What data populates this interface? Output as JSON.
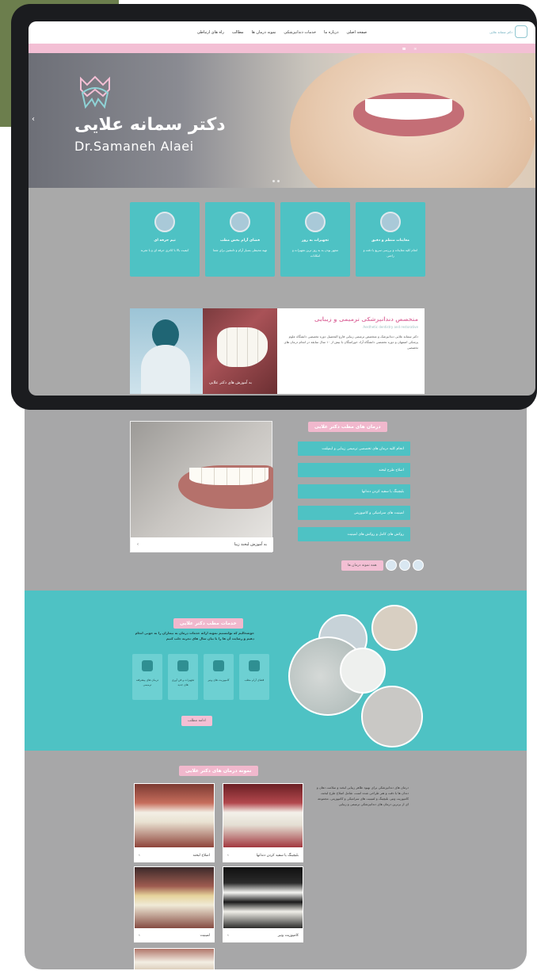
{
  "nav": {
    "items": [
      "صفحه اصلی",
      "درباره ما",
      "خدمات دندانپزشکی",
      "نمونه درمان ها",
      "مطالب",
      "راه های ارتباطی"
    ],
    "logo_text": "دکتر سمانه علایی"
  },
  "hero": {
    "title_fa": "دکتر سمانه علایی",
    "title_en": "Dr.Samaneh Alaei"
  },
  "service_cards": [
    {
      "title": "معاینات منظم و دقیق",
      "desc": "انجام کلیه معاینات و بررسی سریع با دقت و راحتی"
    },
    {
      "title": "تجهیزات به روز",
      "desc": "مجهز بودن به به روز ترین تجهیزات و امکانات"
    },
    {
      "title": "فضای آرام بخش مطب",
      "desc": "تهیه محیطی بسیار آرام و دلنشین برای شما"
    },
    {
      "title": "تیم حرفه ای",
      "desc": "کیفیت بالا با کادری حرفه ای و با تجربه"
    }
  ],
  "about": {
    "heading": "متخصص دندانپزشکی ترمیمی و زیبایی",
    "sub": "Aesthetic dentistry and restorative",
    "para": "دکتر سمانه علایی دندانپزشک و متخصص ترمیمی زیبایی فارغ التحصیل دوره تخصصی دانشگاه علوم پزشکی اصفهان و دوره تخصصی دانشگاه آزاد خوراسگان با بیش از ۱۰ سال سابقه در انجام درمان های تخصصی",
    "image_caption": "به آموزش های دکتر علایی"
  },
  "section1": {
    "title": "درمان های مطب دکتر علایی",
    "items": [
      "انجام کلیه درمان های تخصصی ترمیمی زیبایی و ایمپلنت",
      "اصلاح طرح لبخند",
      "بلیچینگ یا سفید کردن دندانها",
      "لمینیت های سرامیکی و کامپوزیتی",
      "روکش های کامل و روکش های لمینیت"
    ],
    "image_caption": "به آموزش لبخند زیبا",
    "more_button": "همه نمونه درمان ها"
  },
  "teal_section": {
    "title": "خدمات مطب دکتر علایی",
    "desc": "خوشحالیم که توانستیم نمونه ارائه خدمات درمان به بیماران را به خوبی انجام دهیم و رضایت آن ها را با بیان سال های تجربه جلب کنیم",
    "cards": [
      "فضای آرام مطب",
      "کامپوزیت های ونیر",
      "تجهیزات و فن آوری های جدید",
      "درمان های پیشرفته ترمیمی"
    ],
    "more_button": "ادامه مطلب"
  },
  "gallery": {
    "title": "نمونه درمان های دکتر علایی",
    "desc": "درمان های دندانپزشکی برای بهبود ظاهر زیبایی لبخند و سلامت دهان و دندان ها با دقت و هنر طراحی شده است، شامل اصلاح طرح لبخند، کامپوزیت ونیر، بلیچینگ و لمینیت های سرامیکی و کامپوزیتی. مجموعه ای از برترین درمان های دندانپزشکی ترمیمی و زیبایی",
    "items": [
      {
        "caption": "اصلاح لبخند"
      },
      {
        "caption": "بلیچینگ یا سفید کردن دندانها"
      },
      {
        "caption": "لمینیت"
      },
      {
        "caption": "کامپوزیت ونیر"
      }
    ]
  },
  "colors": {
    "teal": "#4ec2c4",
    "pink": "#f3bfd4",
    "frame": "#1b1c1f",
    "olive": "#6c7e4d"
  }
}
